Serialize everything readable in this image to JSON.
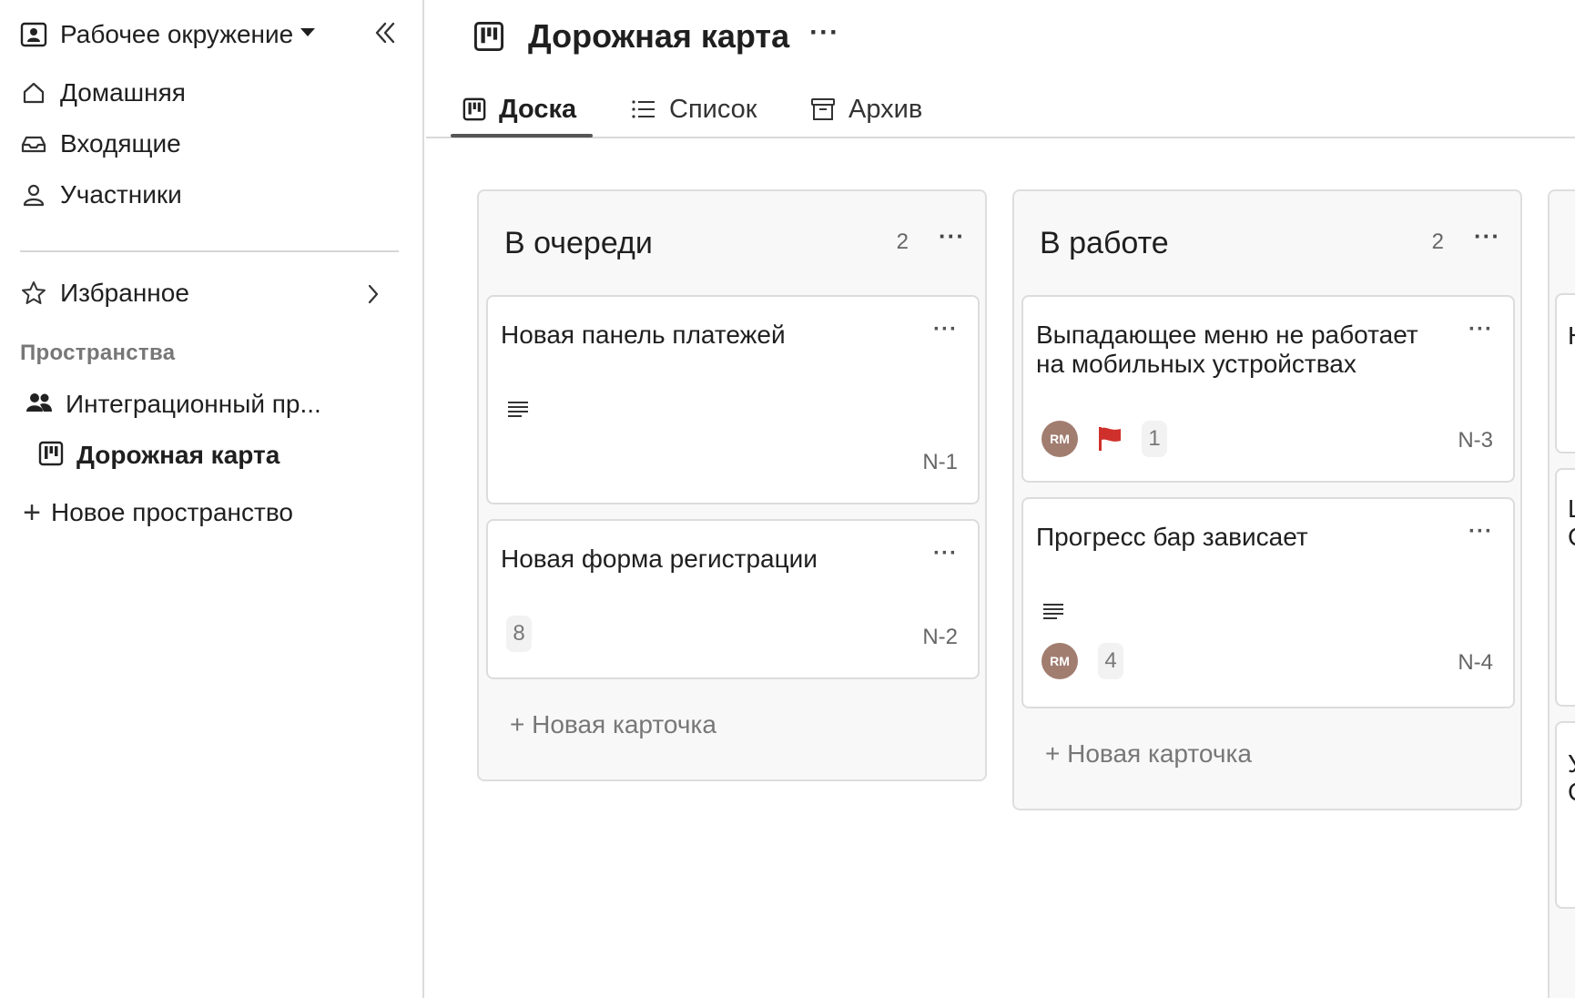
{
  "sidebar": {
    "workspace_label": "Рабочее окружение",
    "nav": [
      {
        "label": "Домашняя",
        "icon": "home-icon"
      },
      {
        "label": "Входящие",
        "icon": "inbox-icon"
      },
      {
        "label": "Участники",
        "icon": "user-icon"
      }
    ],
    "favorites_label": "Избранное",
    "spaces_heading": "Пространства",
    "space_name": "Интеграционный пр...",
    "board_name": "Дорожная карта",
    "new_space_label": "Новое пространство"
  },
  "header": {
    "title": "Дорожная карта",
    "more": "···"
  },
  "tabs": [
    {
      "label": "Доска",
      "icon": "board-icon",
      "active": true
    },
    {
      "label": "Список",
      "icon": "list-icon",
      "active": false
    },
    {
      "label": "Архив",
      "icon": "archive-icon",
      "active": false
    }
  ],
  "columns": [
    {
      "title": "В очереди",
      "count": "2",
      "new_card_label": "+ Новая карточка",
      "cards": [
        {
          "title": "Новая панель платежей",
          "id": "N-1",
          "has_description": true
        },
        {
          "title": "Новая форма регистрации",
          "id": "N-2",
          "badge": "8"
        }
      ]
    },
    {
      "title": "В работе",
      "count": "2",
      "new_card_label": "+ Новая карточка",
      "cards": [
        {
          "title": "Выпадающее меню не работает на мобильных устройствах",
          "id": "N-3",
          "assignee": "RM",
          "flag": true,
          "badge": "1"
        },
        {
          "title": "Прогресс бар зависает",
          "id": "N-4",
          "has_description": true,
          "assignee": "RM",
          "badge": "4"
        }
      ]
    }
  ],
  "colors": {
    "avatar": "#a17d70",
    "flag": "#d0302b"
  },
  "partial_column_chars": [
    "Н",
    "Ш",
    "С",
    "У",
    "С"
  ]
}
